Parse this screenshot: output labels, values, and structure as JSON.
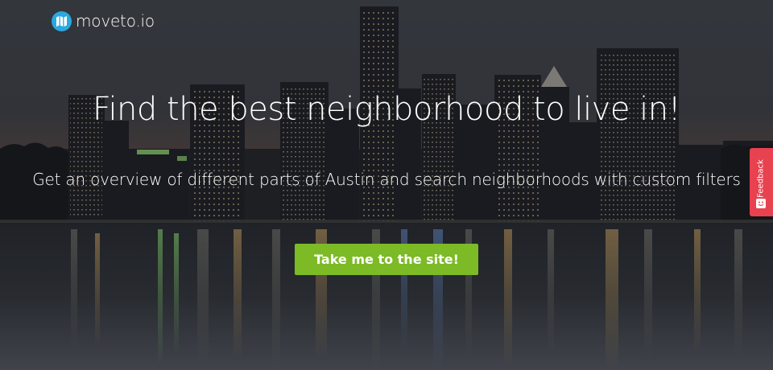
{
  "brand": {
    "name": "moveto.io",
    "icon": "map-icon",
    "icon_color": "#29a9e0"
  },
  "hero": {
    "headline": "Find the best neighborhood to live in!",
    "subheadline": "Get an overview of different parts of Austin and search neighborhoods with custom filters",
    "cta_label": "Take me to the site!",
    "cta_color": "#7cba26",
    "background": "austin-skyline-night-photo"
  },
  "feedback": {
    "label": "Feedback",
    "icon": "smile-icon",
    "color": "#e8414f"
  }
}
